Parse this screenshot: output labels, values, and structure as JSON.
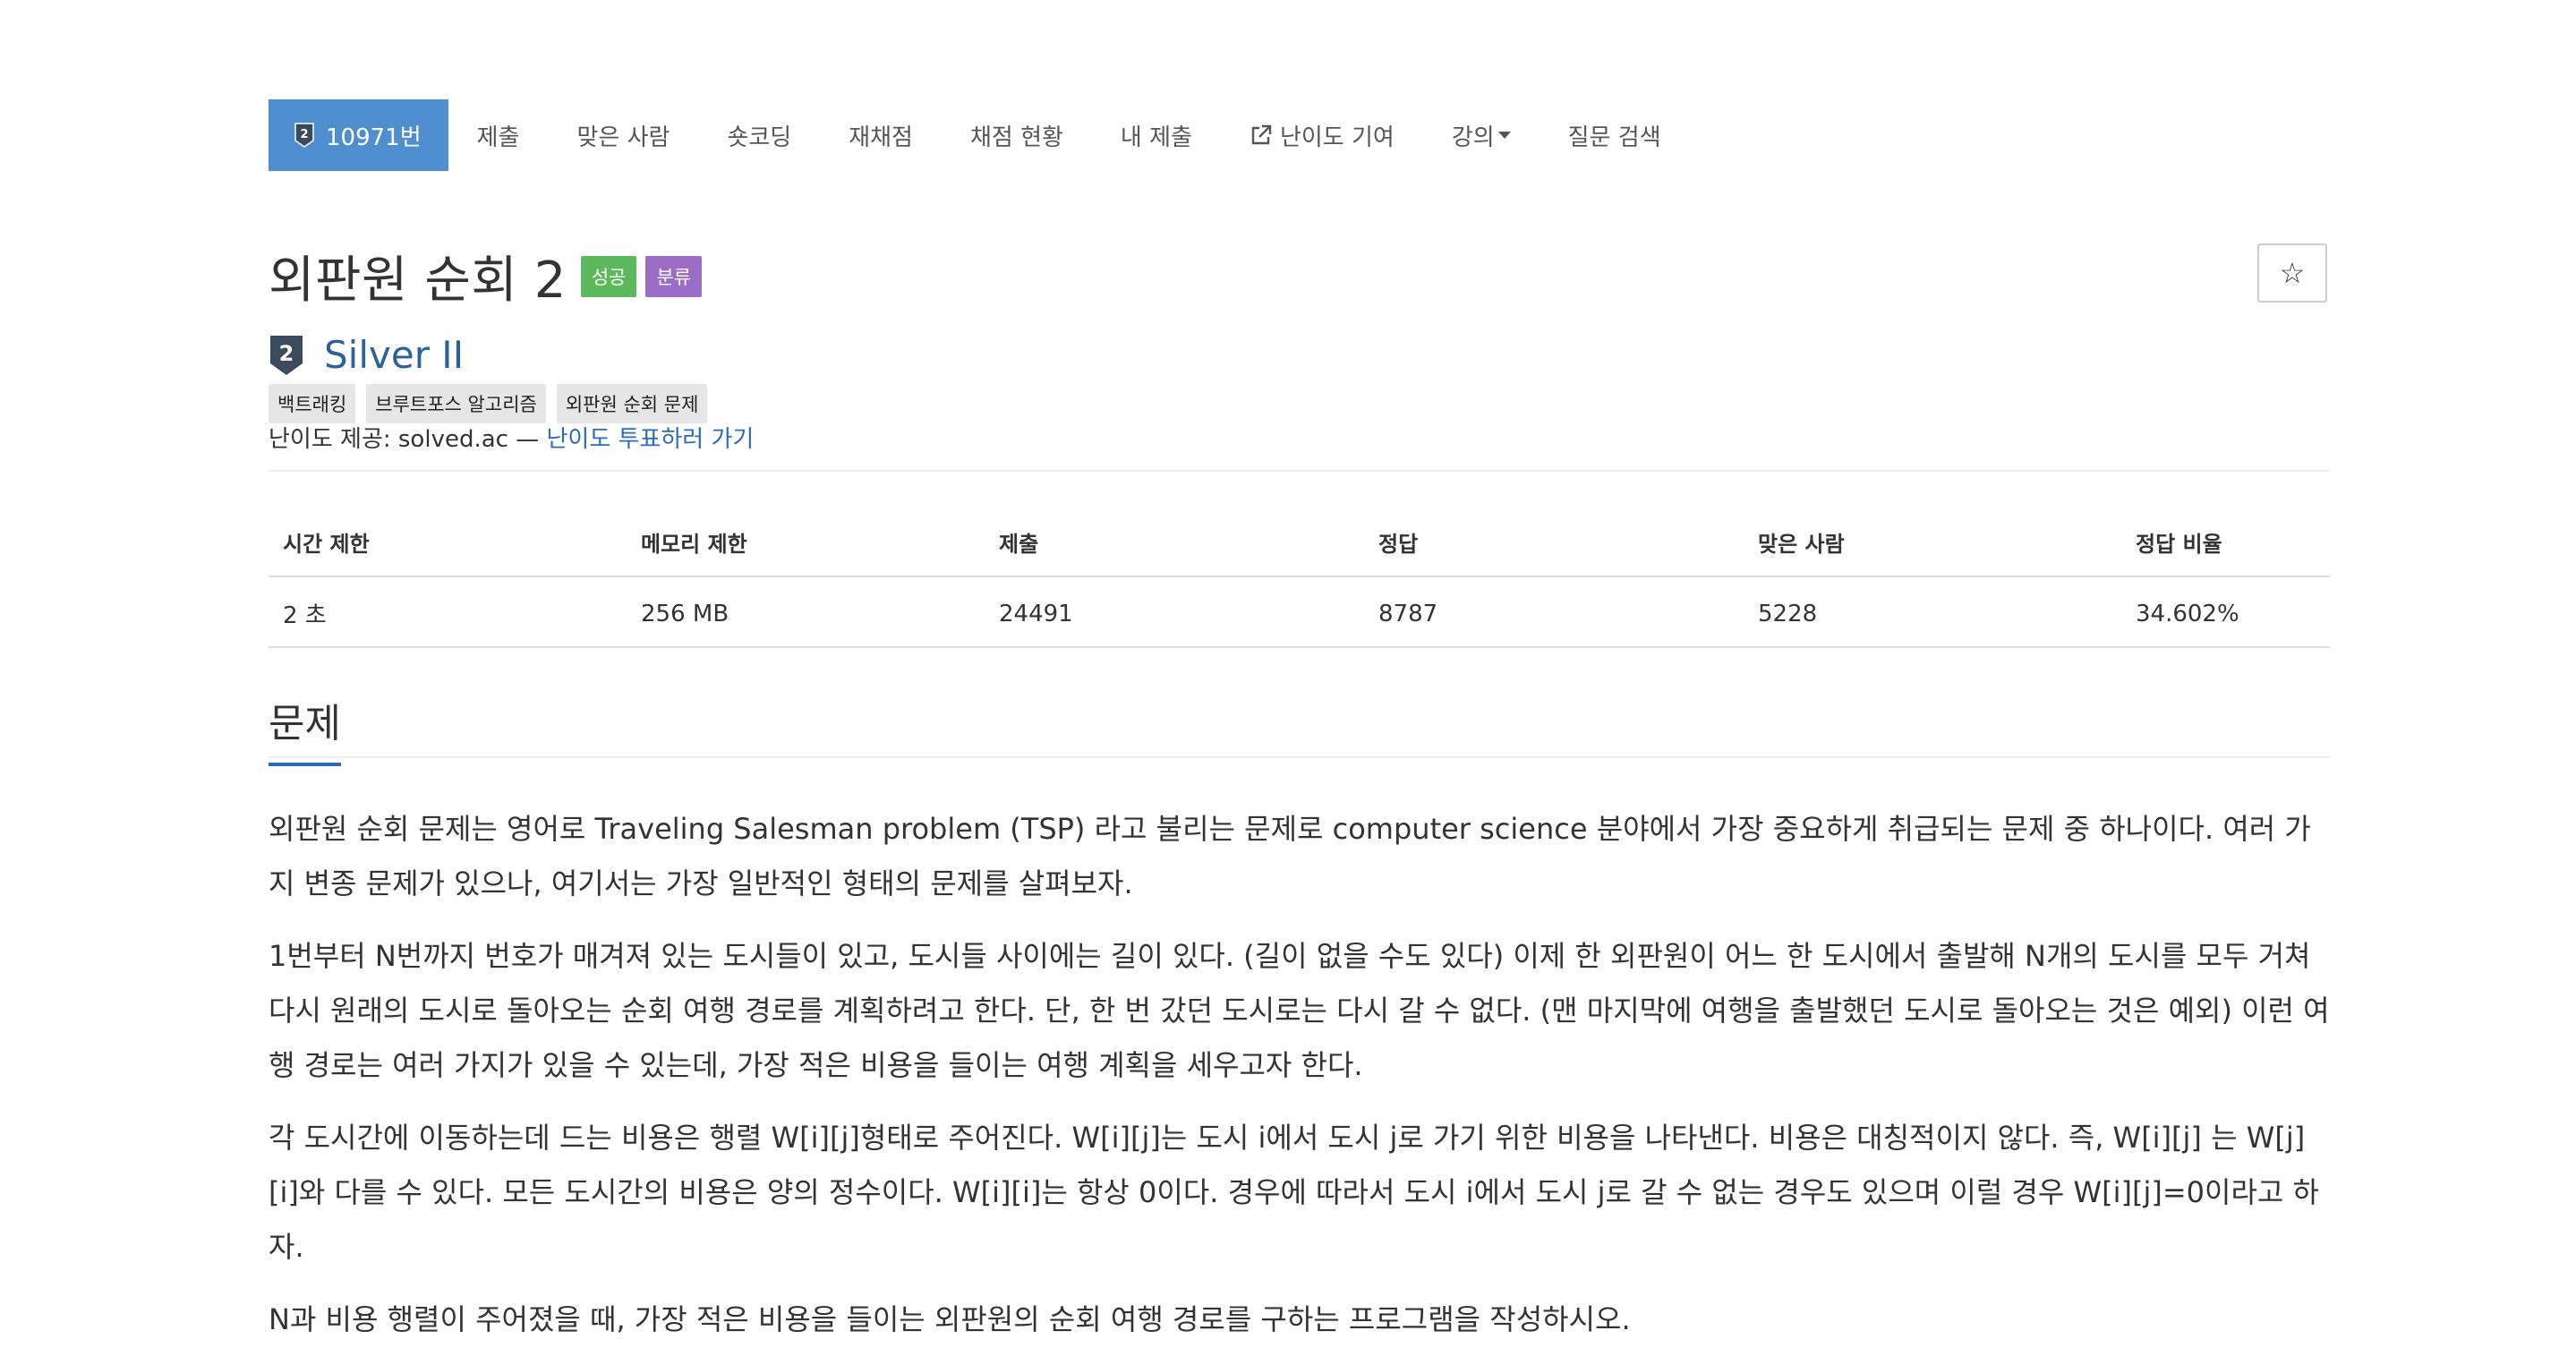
{
  "tabs": [
    {
      "label": "10971번",
      "active": true
    },
    {
      "label": "제출"
    },
    {
      "label": "맞은 사람"
    },
    {
      "label": "숏코딩"
    },
    {
      "label": "재채점"
    },
    {
      "label": "채점 현황"
    },
    {
      "label": "내 제출"
    },
    {
      "label": "난이도 기여"
    },
    {
      "label": "강의"
    },
    {
      "label": "질문 검색"
    }
  ],
  "problem": {
    "title": "외판원 순회 2",
    "badges": [
      "성공",
      "분류"
    ],
    "star_label": "☆",
    "tier": "Silver II",
    "tier_number": "2",
    "tags": [
      "백트래킹",
      "브루트포스 알고리즘",
      "외판원 순회 문제"
    ],
    "provider_prefix": "난이도 제공: solved.ac —",
    "provider_link": "난이도 투표하러 가기"
  },
  "info": {
    "headers": [
      "시간 제한",
      "메모리 제한",
      "제출",
      "정답",
      "맞은 사람",
      "정답 비율"
    ],
    "values": [
      "2 초",
      "256 MB",
      "24491",
      "8787",
      "5228",
      "34.602%"
    ]
  },
  "section": {
    "heading": "문제",
    "paragraphs": [
      "외판원 순회 문제는 영어로 Traveling Salesman problem (TSP) 라고 불리는 문제로 computer science 분야에서 가장 중요하게 취급되는 문제 중 하나이다. 여러 가지 변종 문제가 있으나, 여기서는 가장 일반적인 형태의 문제를 살펴보자.",
      "1번부터 N번까지 번호가 매겨져 있는 도시들이 있고, 도시들 사이에는 길이 있다. (길이 없을 수도 있다) 이제 한 외판원이 어느 한 도시에서 출발해 N개의 도시를 모두 거쳐 다시 원래의 도시로 돌아오는 순회 여행 경로를 계획하려고 한다. 단, 한 번 갔던 도시로는 다시 갈 수 없다. (맨 마지막에 여행을 출발했던 도시로 돌아오는 것은 예외) 이런 여행 경로는 여러 가지가 있을 수 있는데, 가장 적은 비용을 들이는 여행 계획을 세우고자 한다.",
      "각 도시간에 이동하는데 드는 비용은 행렬 W[i][j]형태로 주어진다. W[i][j]는 도시 i에서 도시 j로 가기 위한 비용을 나타낸다. 비용은 대칭적이지 않다. 즉, W[i][j] 는 W[j][i]와 다를 수 있다. 모든 도시간의 비용은 양의 정수이다. W[i][i]는 항상 0이다. 경우에 따라서 도시 i에서 도시 j로 갈 수 없는 경우도 있으며 이럴 경우 W[i][j]=0이라고 하자.",
      "N과 비용 행렬이 주어졌을 때, 가장 적은 비용을 들이는 외판원의 순회 여행 경로를 구하는 프로그램을 작성하시오."
    ]
  },
  "colors": {
    "accent": "#4f8fcf",
    "link": "#2a6cbb",
    "success_badge": "#5cb85c",
    "category_badge": "#9b6dc6",
    "tier_text": "#2b6299"
  },
  "icons": {
    "tier": "silver-tier-icon",
    "external": "external-link-icon",
    "star": "star-icon",
    "caret": "caret-down-icon"
  }
}
